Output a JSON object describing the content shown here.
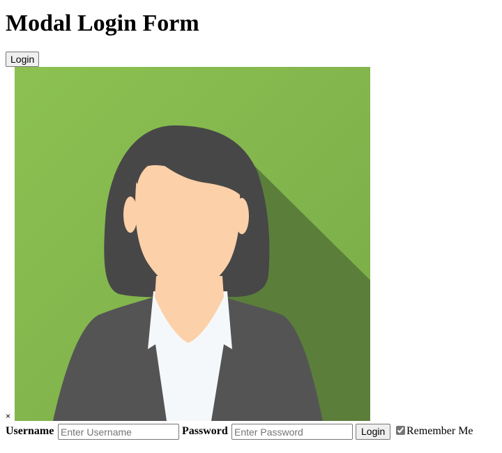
{
  "page": {
    "title": "Modal Login Form"
  },
  "open_button": {
    "label": "Login"
  },
  "avatar": {
    "icon": "woman-avatar-icon",
    "colors": {
      "background": "#8bc34a",
      "shadow": "#5a7f3a",
      "hair": "#474747",
      "skin": "#fcd0a8",
      "jacket": "#545454",
      "shirt": "#f5f8fa"
    }
  },
  "close": {
    "symbol": "×"
  },
  "form": {
    "username_label": "Username",
    "username_placeholder": "Enter Username",
    "username_value": "",
    "password_label": "Password",
    "password_placeholder": "Enter Password",
    "password_value": "",
    "submit_label": "Login",
    "remember_label": "Remember Me",
    "remember_checked": true
  }
}
